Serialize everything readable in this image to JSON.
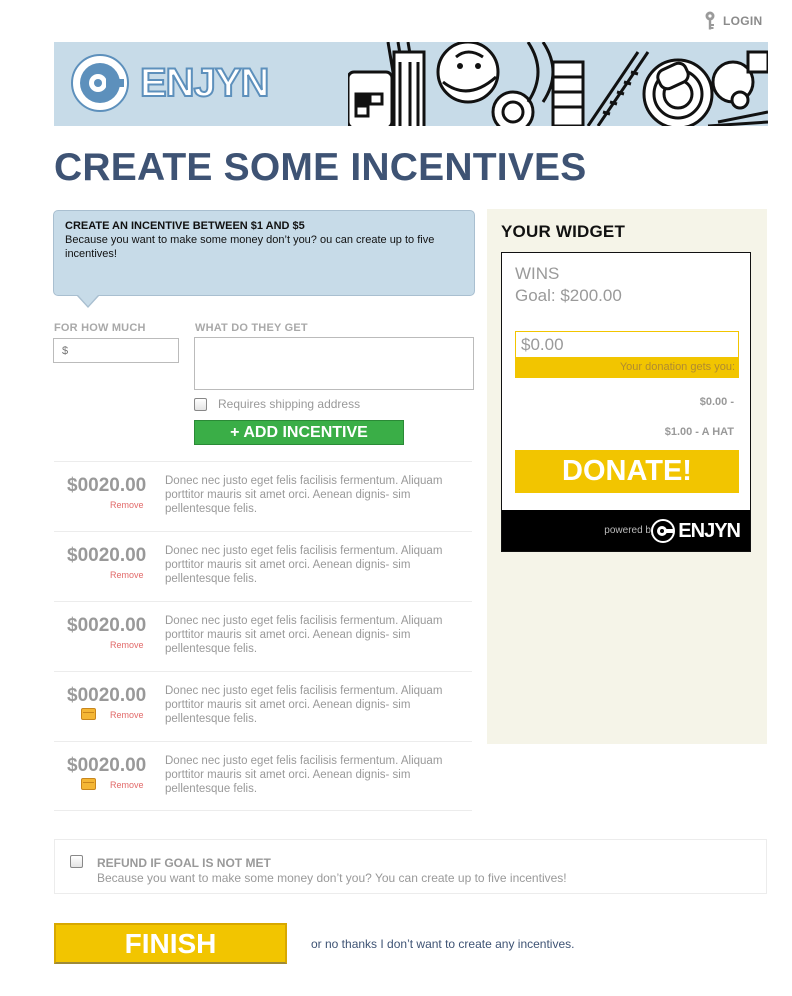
{
  "header": {
    "login_label": "LOGIN",
    "brand_name": "ENJYN"
  },
  "page": {
    "title": "CREATE SOME INCENTIVES"
  },
  "info": {
    "title": "CREATE AN INCENTIVE BETWEEN $1 AND $5",
    "text": "Because you want to make some money don’t you? ou can create up to five incentives!"
  },
  "form": {
    "amount_label": "FOR HOW MUCH",
    "amount_placeholder": "$",
    "reward_label": "WHAT DO THEY GET",
    "shipping_label": "Requires shipping address",
    "add_button": "+ ADD INCENTIVE"
  },
  "incentives": [
    {
      "amount": "$0020.00",
      "remove": "Remove",
      "has_shipping": false,
      "description": "Donec nec justo eget felis facilisis fermentum. Aliquam porttitor mauris sit amet orci.  Aenean dignis- sim pellentesque felis."
    },
    {
      "amount": "$0020.00",
      "remove": "Remove",
      "has_shipping": false,
      "description": "Donec nec justo eget felis facilisis fermentum. Aliquam porttitor mauris sit amet orci.  Aenean dignis- sim pellentesque felis."
    },
    {
      "amount": "$0020.00",
      "remove": "Remove",
      "has_shipping": false,
      "description": "Donec nec justo eget felis facilisis fermentum. Aliquam porttitor mauris sit amet orci.  Aenean dignis- sim pellentesque felis."
    },
    {
      "amount": "$0020.00",
      "remove": "Remove",
      "has_shipping": true,
      "description": "Donec nec justo eget felis facilisis fermentum. Aliquam porttitor mauris sit amet orci.  Aenean dignis- sim pellentesque felis."
    },
    {
      "amount": "$0020.00",
      "remove": "Remove",
      "has_shipping": true,
      "description": "Donec nec justo eget felis facilisis fermentum. Aliquam porttitor mauris sit amet orci.  Aenean dignis- sim pellentesque felis."
    }
  ],
  "widget": {
    "title": "YOUR WIDGET",
    "name": "WINS",
    "goal": "Goal: $200.00",
    "amount_value": "$0.00",
    "gets_label": "Your donation gets you:",
    "options": [
      "$0.00 -",
      "$1.00 - A HAT"
    ],
    "donate_label": "DONATE!",
    "powered_by": "powered by",
    "brand_name": "ENJYN"
  },
  "refund": {
    "title": "REFUND IF GOAL IS NOT MET",
    "text": "Because you want to make some money don’t you? You can create up to five incentives!"
  },
  "footer": {
    "finish_label": "FINISH",
    "no_thanks": "or no thanks I don’t want to create any incentives."
  },
  "colors": {
    "banner": "#c7dbe8",
    "title": "#3e5374",
    "green": "#3aae47",
    "yellow": "#f2c500",
    "remove": "#e26a6a"
  },
  "icons": [
    "key-icon",
    "enjyn-logo-icon",
    "shipping-box-icon",
    "checkbox-icon"
  ]
}
